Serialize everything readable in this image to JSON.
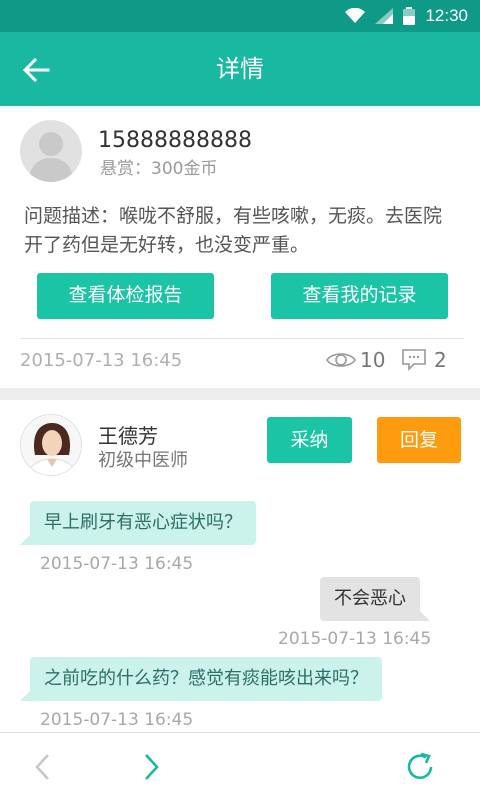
{
  "status_bar": {
    "time": "12:30",
    "icons": [
      "wifi-icon",
      "signal-icon",
      "battery-icon"
    ]
  },
  "header": {
    "title": "详情",
    "back_icon": "arrow-left-icon"
  },
  "question": {
    "user": "15888888888",
    "reward": "悬赏：300金币",
    "description": "问题描述：喉咙不舒服，有些咳嗽，无痰。去医院开了药但是无好转，也没变严重。",
    "buttons": {
      "report": "查看体检报告",
      "records": "查看我的记录"
    },
    "time": "2015-07-13 16:45",
    "views": "10",
    "comments": "2"
  },
  "doctor": {
    "name": "王德芳",
    "title": "初级中医师",
    "adopt_label": "采纳",
    "reply_label": "回复"
  },
  "messages": [
    {
      "side": "left",
      "text": "早上刷牙有恶心症状吗？",
      "time": "2015-07-13  16:45"
    },
    {
      "side": "right",
      "text": "不会恶心",
      "time": "2015-07-13  16:45"
    },
    {
      "side": "left",
      "text": "之前吃的什么药？感觉有痰能咳出来吗？",
      "time": "2015-07-13  16:45"
    }
  ],
  "bottom_nav": {
    "prev": "chevron-left-icon",
    "next": "chevron-right-icon",
    "refresh": "refresh-icon"
  },
  "colors": {
    "primary": "#18b9a0",
    "status_bar": "#0e9a87",
    "button_green": "#1bc4a4",
    "button_orange": "#ff9b0e",
    "bubble_left": "#ccf2ec",
    "bubble_right": "#e3e3e3"
  }
}
